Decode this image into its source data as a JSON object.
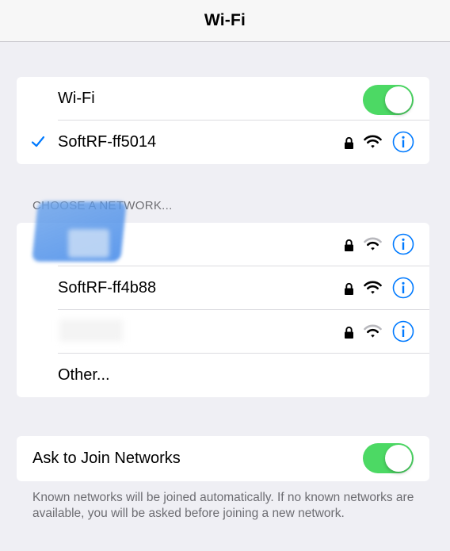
{
  "nav": {
    "title": "Wi-Fi"
  },
  "wifi_section": {
    "toggle_label": "Wi-Fi",
    "toggle_on": true,
    "connected_network": "SoftRF-ff5014"
  },
  "networks_section": {
    "header": "CHOOSE A NETWORK...",
    "networks": [
      {
        "name": "",
        "secured": true,
        "signal": "medium"
      },
      {
        "name": "SoftRF-ff4b88",
        "secured": true,
        "signal": "full"
      },
      {
        "name": "",
        "secured": true,
        "signal": "medium"
      }
    ],
    "other_label": "Other..."
  },
  "ask_join": {
    "label": "Ask to Join Networks",
    "toggle_on": true,
    "note": "Known networks will be joined automatically. If no known networks are available, you will be asked before joining a new network."
  },
  "colors": {
    "accent": "#007aff",
    "toggle_on": "#4cd964",
    "background": "#efeff4",
    "secondary_text": "#6d6d72"
  },
  "icons": [
    "checkmark-icon",
    "lock-icon",
    "wifi-icon",
    "info-icon"
  ]
}
